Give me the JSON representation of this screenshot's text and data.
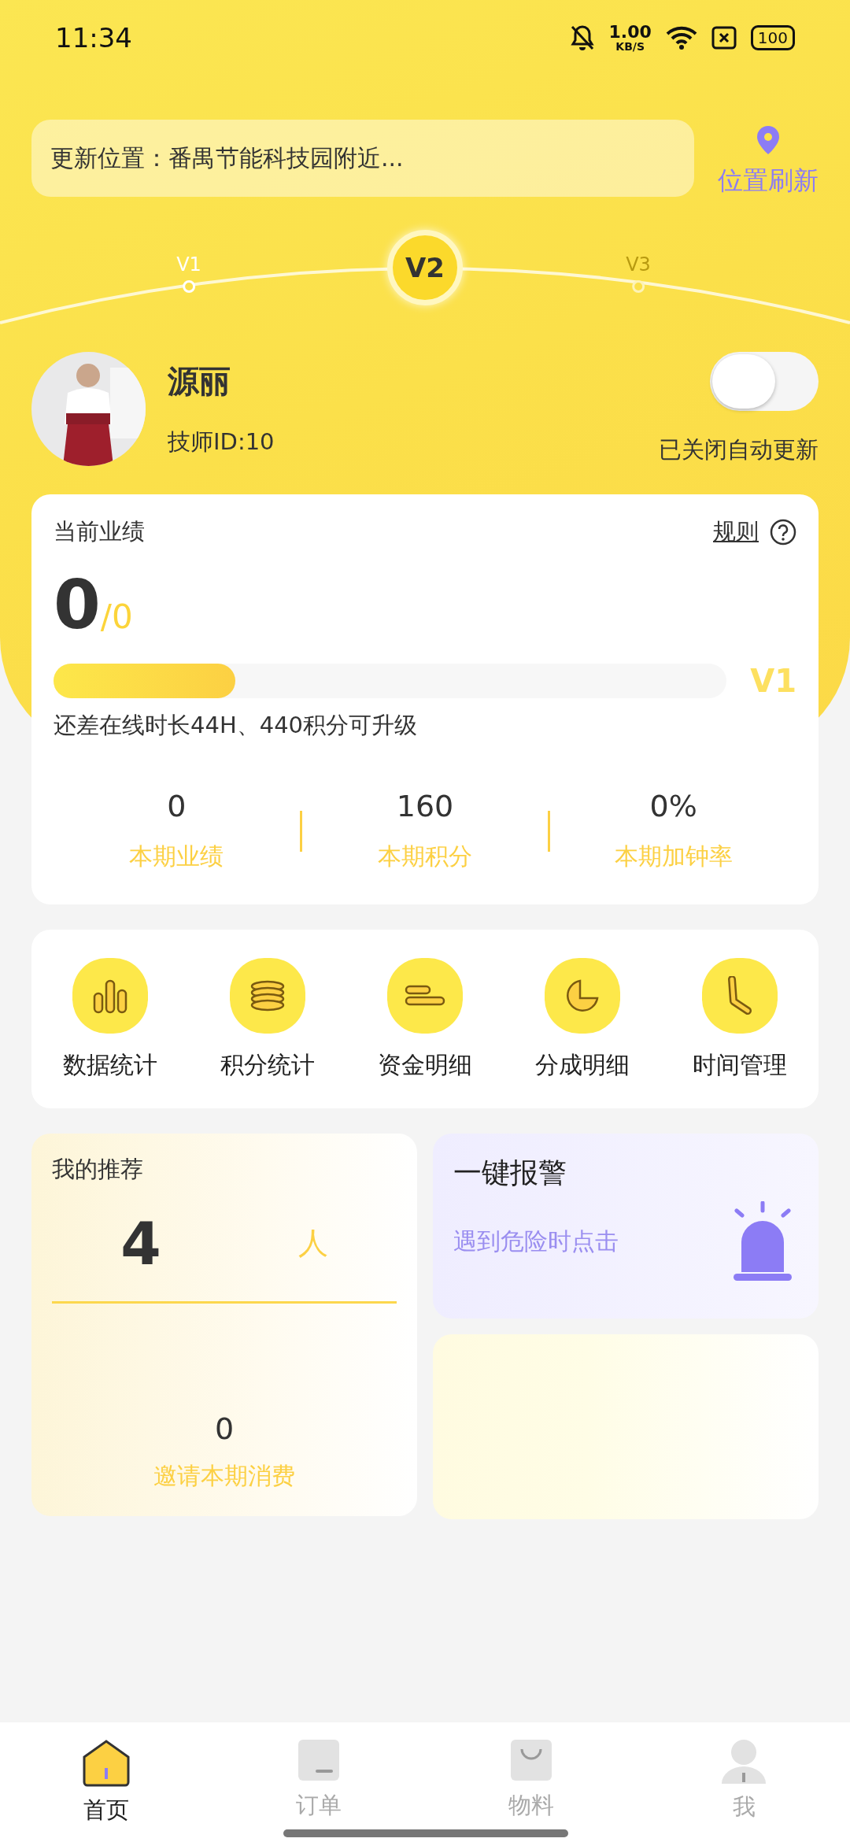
{
  "status_bar": {
    "time": "11:34",
    "speed_value": "1.00",
    "speed_unit": "KB/S",
    "battery": "100"
  },
  "location": {
    "text": "更新位置：番禺节能科技园附近...",
    "refresh": "位置刷新"
  },
  "levels": [
    {
      "label": "V1",
      "selected": false
    },
    {
      "label": "V2",
      "selected": true
    },
    {
      "label": "V3",
      "selected": false
    }
  ],
  "profile": {
    "name": "源丽",
    "id": "技师ID:10",
    "auto_update": {
      "on": false,
      "label": "已关闭自动更新"
    }
  },
  "performance": {
    "title": "当前业绩",
    "rules": "规则",
    "current": "0",
    "target": "/0",
    "progress": {
      "level": 0.27,
      "label": "V1"
    },
    "hint": "还差在线时长44H、440积分可升级",
    "stats": [
      {
        "value": "0",
        "label": "本期业绩"
      },
      {
        "value": "160",
        "label": "本期积分"
      },
      {
        "value": "0%",
        "label": "本期加钟率"
      }
    ]
  },
  "shortcuts": [
    {
      "kind": "bars",
      "label": "数据统计"
    },
    {
      "kind": "coins",
      "label": "积分统计"
    },
    {
      "kind": "lines",
      "label": "资金明细"
    },
    {
      "kind": "pie",
      "label": "分成明细"
    },
    {
      "kind": "clock",
      "label": "时间管理"
    }
  ],
  "recommend": {
    "title": "我的推荐",
    "count": "4",
    "unit": "人",
    "sub_value": "0",
    "sub_label": "邀请本期消费"
  },
  "alarm": {
    "title": "一键报警",
    "subtitle": "遇到危险时点击"
  },
  "tabs": [
    {
      "kind": "home",
      "label": "首页",
      "selected": true
    },
    {
      "kind": "order",
      "label": "订单",
      "selected": false
    },
    {
      "kind": "bag",
      "label": "物料",
      "selected": false
    },
    {
      "kind": "person",
      "label": "我",
      "selected": false
    }
  ]
}
